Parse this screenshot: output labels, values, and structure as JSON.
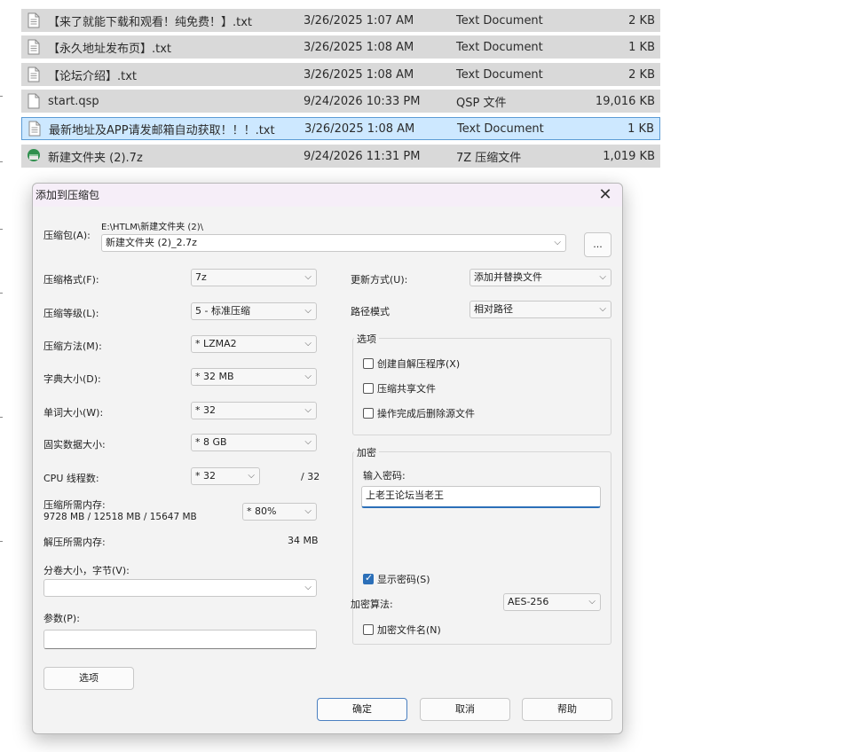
{
  "files": [
    {
      "name": "【来了就能下载和观看！纯免费！】.txt",
      "date": "3/26/2025 1:07 AM",
      "type": "Text Document",
      "size": "2 KB",
      "icon": "text-file-icon"
    },
    {
      "name": "【永久地址发布页】.txt",
      "date": "3/26/2025 1:08 AM",
      "type": "Text Document",
      "size": "1 KB",
      "icon": "text-file-icon"
    },
    {
      "name": "【论坛介绍】.txt",
      "date": "3/26/2025 1:08 AM",
      "type": "Text Document",
      "size": "2 KB",
      "icon": "text-file-icon"
    },
    {
      "name": "start.qsp",
      "date": "9/24/2026 10:33 PM",
      "type": "QSP 文件",
      "size": "19,016 KB",
      "icon": "file-icon"
    },
    {
      "name": "最新地址及APP请发邮箱自动获取！！！.txt",
      "date": "3/26/2025 1:08 AM",
      "type": "Text Document",
      "size": "1 KB",
      "icon": "text-file-icon",
      "selected": true
    },
    {
      "name": "新建文件夹 (2).7z",
      "date": "9/24/2026 11:31 PM",
      "type": "7Z 压缩文件",
      "size": "1,019 KB",
      "icon": "archive-icon"
    }
  ],
  "dialog": {
    "title": "添加到压缩包",
    "archive_label": "压缩包(A):",
    "archive_path": "E:\\HTLM\\新建文件夹 (2)\\",
    "archive_name": "新建文件夹 (2)_2.7z",
    "browse_label": "...",
    "format_label": "压缩格式(F):",
    "format_value": "7z",
    "level_label": "压缩等级(L):",
    "level_value": "5 - 标准压缩",
    "method_label": "压缩方法(M):",
    "method_value": "* LZMA2",
    "dict_label": "字典大小(D):",
    "dict_value": "* 32 MB",
    "word_label": "单词大小(W):",
    "word_value": "* 32",
    "solid_label": "固实数据大小:",
    "solid_value": "* 8 GB",
    "cpu_label": "CPU 线程数:",
    "cpu_value": "* 32",
    "cpu_total": "/ 32",
    "mem_label": "压缩所需内存:",
    "mem_detail": "9728 MB / 12518 MB / 15647 MB",
    "mem_value": "* 80%",
    "decomp_label": "解压所需内存:",
    "decomp_value": "34 MB",
    "split_label": "分卷大小，字节(V):",
    "split_value": "",
    "params_label": "参数(P):",
    "params_value": "",
    "options_button": "选项",
    "update_label": "更新方式(U):",
    "update_value": "添加并替换文件",
    "path_label": "路径模式",
    "path_value": "相对路径",
    "options_group": "选项",
    "opt_sfx": "创建自解压程序(X)",
    "opt_shared": "压缩共享文件",
    "opt_delete": "操作完成后删除源文件",
    "enc_group": "加密",
    "enc_password_label": "输入密码:",
    "enc_password_value": "上老王论坛当老王",
    "show_password": "显示密码(S)",
    "enc_method_label": "加密算法:",
    "enc_method_value": "AES-256",
    "enc_filenames": "加密文件名(N)",
    "ok_button": "确定",
    "cancel_button": "取消",
    "help_button": "帮助"
  }
}
